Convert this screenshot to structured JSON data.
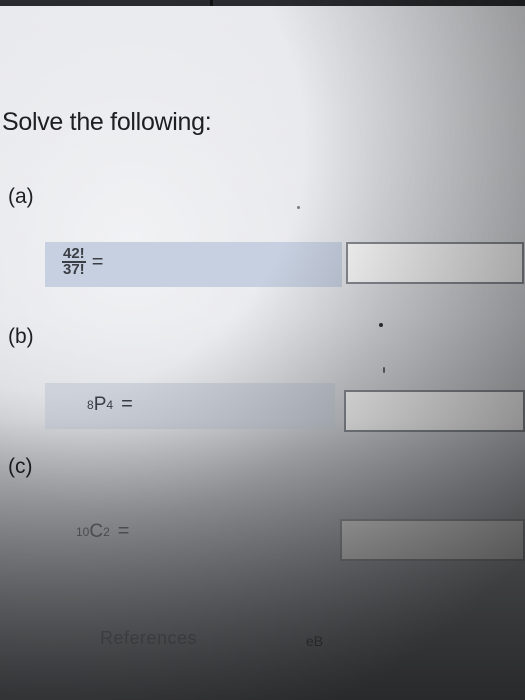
{
  "question": {
    "title": "Solve the following:"
  },
  "parts": [
    {
      "label": "(a)",
      "numerator": "42!",
      "denominator": "37!",
      "equals": "=",
      "answer": ""
    },
    {
      "label": "(b)",
      "pre_subscript": "8",
      "symbol": "P",
      "post_subscript": "4",
      "equals": "=",
      "answer": ""
    },
    {
      "label": "(c)",
      "pre_subscript": "10",
      "symbol": "C",
      "post_subscript": "2",
      "equals": "=",
      "answer": ""
    }
  ],
  "footer": {
    "references_label": "References",
    "ebook_label": "eB"
  },
  "colors": {
    "row_highlight": "#c7d0e0",
    "answer_border": "#8a8e95"
  }
}
